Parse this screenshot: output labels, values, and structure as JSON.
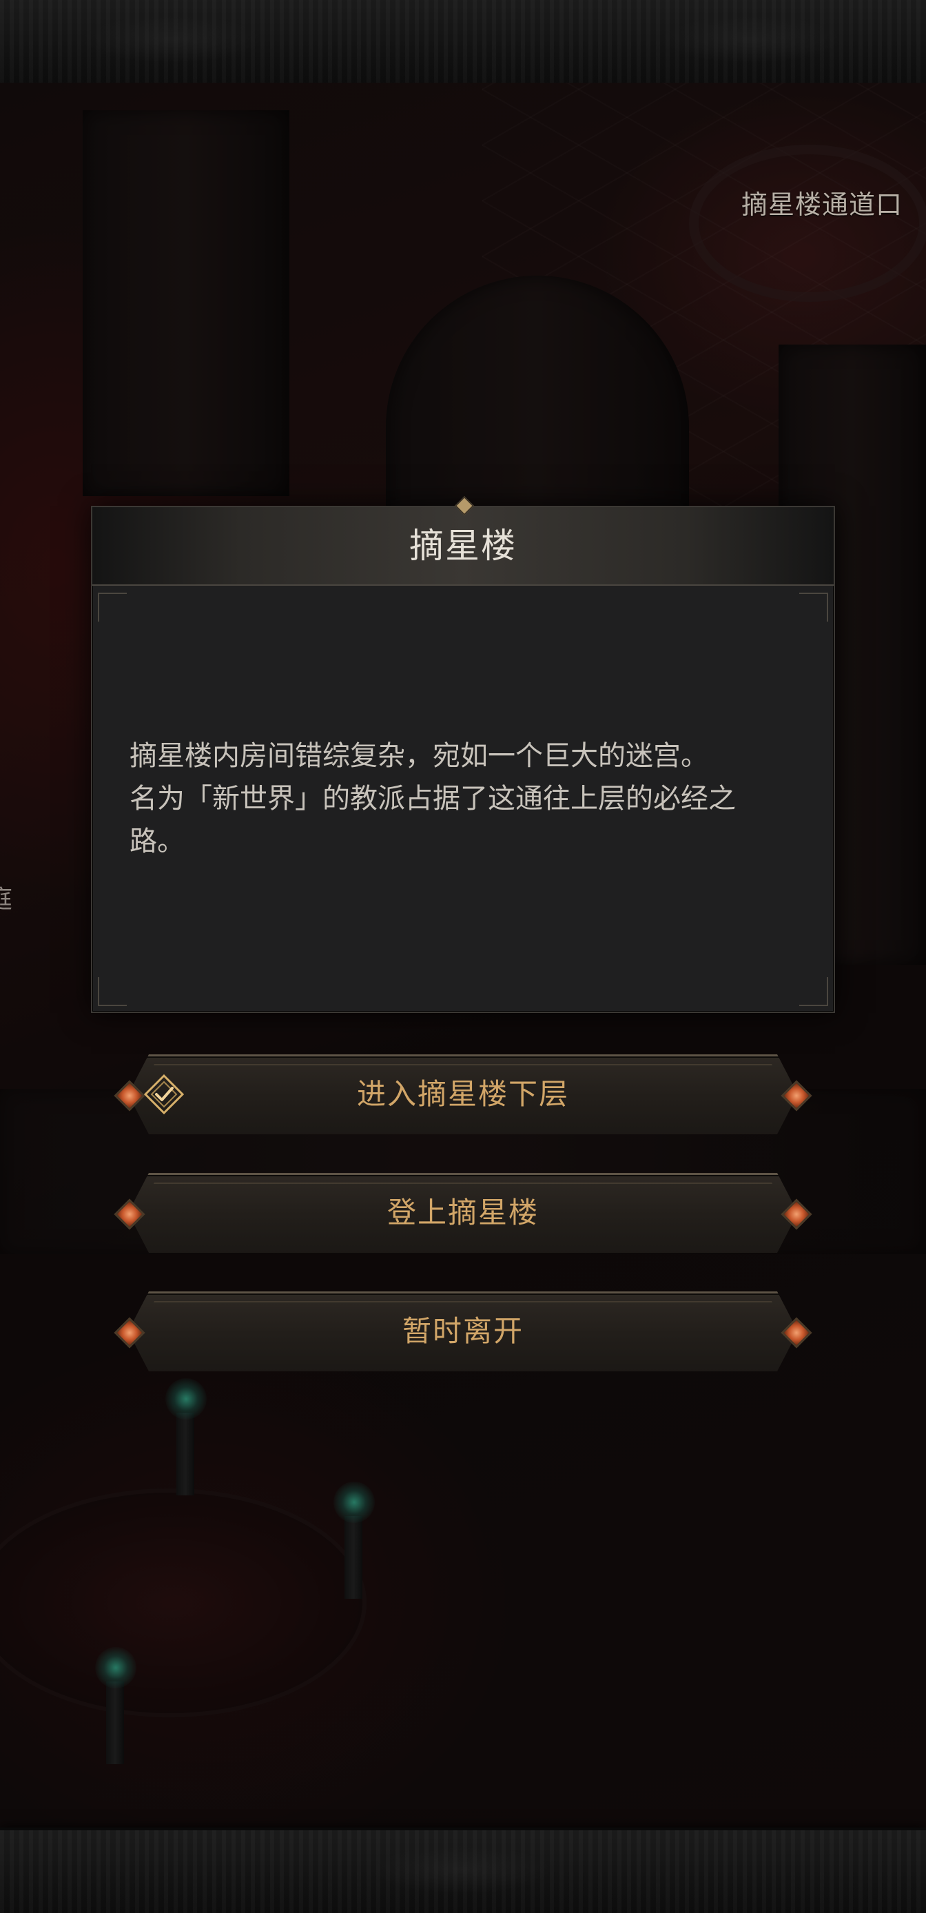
{
  "map": {
    "location_label": "摘星楼通道口",
    "left_edge_label": "庭"
  },
  "dialog": {
    "title": "摘星楼",
    "body_lines": [
      "摘星楼内房间错综复杂，宛如一个巨大的迷宫。",
      "名为「新世界」的教派占据了这通往上层的必经之",
      "路。"
    ]
  },
  "options": [
    {
      "label": "进入摘星楼下层",
      "icon": "checkmark-diamond-icon"
    },
    {
      "label": "登上摘星楼"
    },
    {
      "label": "暂时离开"
    }
  ],
  "colors": {
    "option_text": "#d2a668",
    "dialog_bg": "#1f1f20",
    "gem": "#c8582c",
    "lamp_glow": "#46dcb4"
  }
}
